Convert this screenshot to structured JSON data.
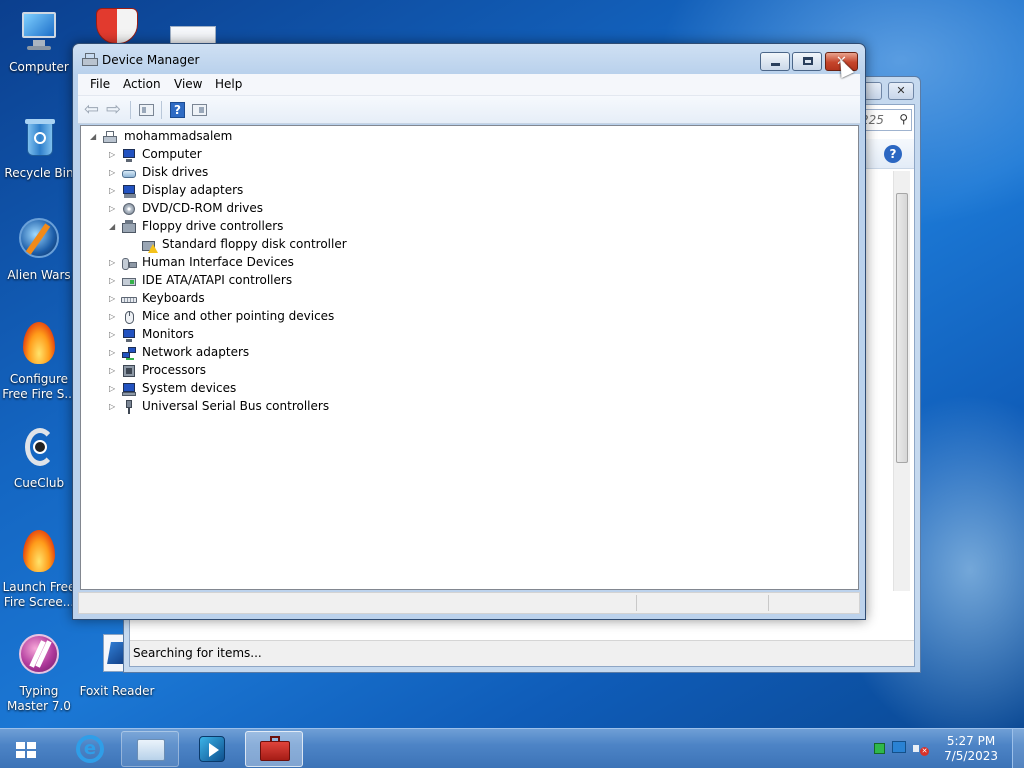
{
  "desktop": {
    "icons": [
      {
        "label": "Computer",
        "icon": "computer-icon"
      },
      {
        "label": "Recycle Bin",
        "icon": "recycle-bin-icon"
      },
      {
        "label": "Alien Wars",
        "icon": "alien-wars-icon"
      },
      {
        "label": "Configure Free Fire S...",
        "line1": "Configure",
        "line2": "Free Fire S...",
        "icon": "flame-icon"
      },
      {
        "label": "CueClub",
        "icon": "cueclub-icon"
      },
      {
        "label": "Launch Free Fire Scree...",
        "line1": "Launch Free",
        "line2": "Fire Scree...",
        "icon": "flame-icon"
      },
      {
        "label": "Typing Master 7.0",
        "line1": "Typing",
        "line2": "Master 7.0",
        "icon": "typing-master-icon"
      },
      {
        "label": "Foxit Reader",
        "icon": "foxit-reader-icon"
      }
    ]
  },
  "background_window": {
    "search_text": "225",
    "status_text": "Searching for items..."
  },
  "device_manager": {
    "title": "Device Manager",
    "menu": [
      "File",
      "Action",
      "View",
      "Help"
    ],
    "tree": {
      "root": "mohammadsalem",
      "items": [
        {
          "label": "Computer",
          "expanded": false,
          "icon": "computer-icon"
        },
        {
          "label": "Disk drives",
          "expanded": false,
          "icon": "disk-drive-icon"
        },
        {
          "label": "Display adapters",
          "expanded": false,
          "icon": "display-adapter-icon"
        },
        {
          "label": "DVD/CD-ROM drives",
          "expanded": false,
          "icon": "dvd-drive-icon"
        },
        {
          "label": "Floppy drive controllers",
          "expanded": true,
          "icon": "floppy-controller-icon",
          "children": [
            {
              "label": "Standard floppy disk controller",
              "icon": "warning-device-icon"
            }
          ]
        },
        {
          "label": "Human Interface Devices",
          "expanded": false,
          "icon": "hid-icon"
        },
        {
          "label": "IDE ATA/ATAPI controllers",
          "expanded": false,
          "icon": "ide-controller-icon"
        },
        {
          "label": "Keyboards",
          "expanded": false,
          "icon": "keyboard-icon"
        },
        {
          "label": "Mice and other pointing devices",
          "expanded": false,
          "icon": "mouse-icon"
        },
        {
          "label": "Monitors",
          "expanded": false,
          "icon": "monitor-icon"
        },
        {
          "label": "Network adapters",
          "expanded": false,
          "icon": "network-adapter-icon"
        },
        {
          "label": "Processors",
          "expanded": false,
          "icon": "processor-icon"
        },
        {
          "label": "System devices",
          "expanded": false,
          "icon": "system-devices-icon"
        },
        {
          "label": "Universal Serial Bus controllers",
          "expanded": false,
          "icon": "usb-icon"
        }
      ]
    }
  },
  "taskbar": {
    "clock_time": "5:27 PM",
    "clock_date": "7/5/2023"
  },
  "colors": {
    "close_button": "#c5442b",
    "desktop_blue": "#1466c2",
    "taskbar": "#4d84c6"
  }
}
